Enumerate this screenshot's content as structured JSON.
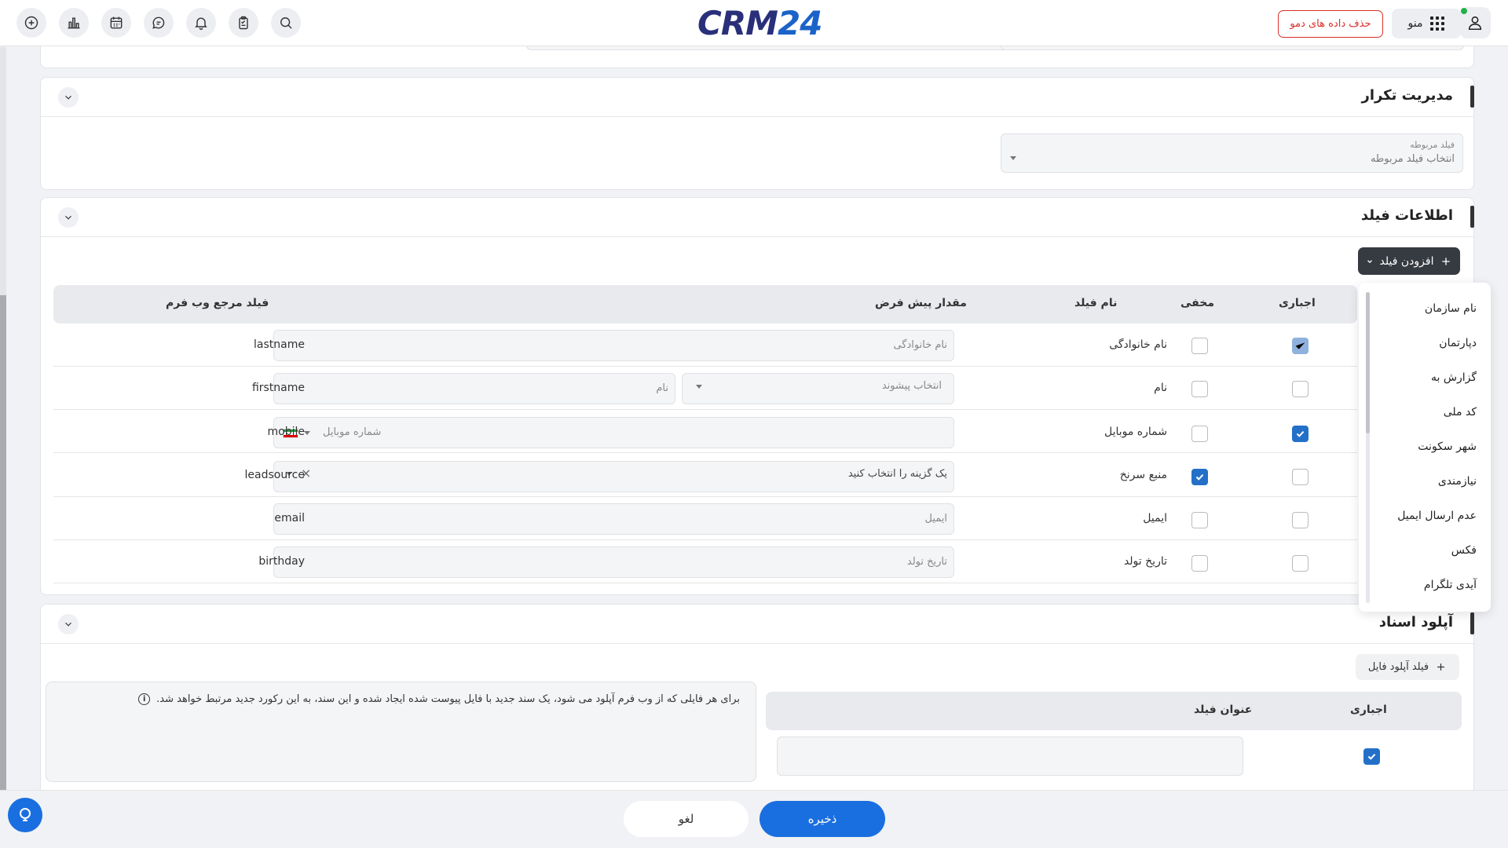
{
  "header": {
    "logo_part1": "CRM",
    "logo_part2": "24",
    "demo_button": "حذف داده های دمو",
    "menu_label": "منو",
    "icons": [
      "add-icon",
      "chart-icon",
      "calendar-icon",
      "chat-icon",
      "bell-icon",
      "clipboard-icon",
      "search-icon"
    ]
  },
  "duplicate_section": {
    "title": "مدیریت تکرار",
    "related_field_label": "فیلد مربوطه",
    "related_field_placeholder": "انتخاب فیلد مربوطه"
  },
  "field_info_section": {
    "title": "اطلاعات فیلد",
    "add_field_button": "افزودن فیلد",
    "columns": {
      "required": "اجباری",
      "hidden": "مخفی",
      "field_name": "نام فیلد",
      "default_value": "مقدار پیش فرض",
      "ref_field": "فیلد مرجع وب فرم"
    },
    "rows": [
      {
        "required": true,
        "required_disabled": true,
        "hidden": false,
        "name": "نام خانوادگی",
        "placeholder": "نام خانوادگی",
        "ref": "lastname"
      },
      {
        "required": false,
        "hidden": false,
        "name": "نام",
        "placeholder": "نام",
        "prefix_placeholder": "انتخاب پیشوند",
        "ref": "firstname"
      },
      {
        "required": true,
        "hidden": false,
        "name": "شماره موبایل",
        "placeholder": "شماره موبایل",
        "ref": "mobile"
      },
      {
        "required": false,
        "hidden": true,
        "name": "منبع سرنخ",
        "placeholder": "یک گزینه را انتخاب کنید",
        "ref": "leadsource"
      },
      {
        "required": false,
        "hidden": false,
        "name": "ایمیل",
        "placeholder": "ایمیل",
        "ref": "email"
      },
      {
        "required": false,
        "hidden": false,
        "name": "تاریخ تولد",
        "placeholder": "تاریخ تولد",
        "ref": "birthday"
      }
    ],
    "dropdown_items": [
      "نام سازمان",
      "دپارتمان",
      "گزارش به",
      "کد ملی",
      "شهر سکونت",
      "نیازمندی",
      "عدم ارسال ایمیل",
      "فکس",
      "آیدی تلگرام"
    ]
  },
  "upload_section": {
    "title": "آپلود اسناد",
    "upload_field_button": "فیلد آپلود فایل",
    "info_text": "برای هر فایلی که از وب فرم آپلود می شود، یک سند جدید با فایل پیوست شده ایجاد شده و این سند، به این رکورد جدید مرتبط خواهد شد.",
    "columns": {
      "required": "اجباری",
      "field_title": "عنوان فیلد"
    },
    "row_required": true
  },
  "footer": {
    "save_button": "ذخیره",
    "cancel_button": "لغو"
  },
  "colors": {
    "primary": "#1a6fe0",
    "danger": "#d9312c",
    "dark_button": "#363a41",
    "checkbox_on": "#2470c8"
  }
}
